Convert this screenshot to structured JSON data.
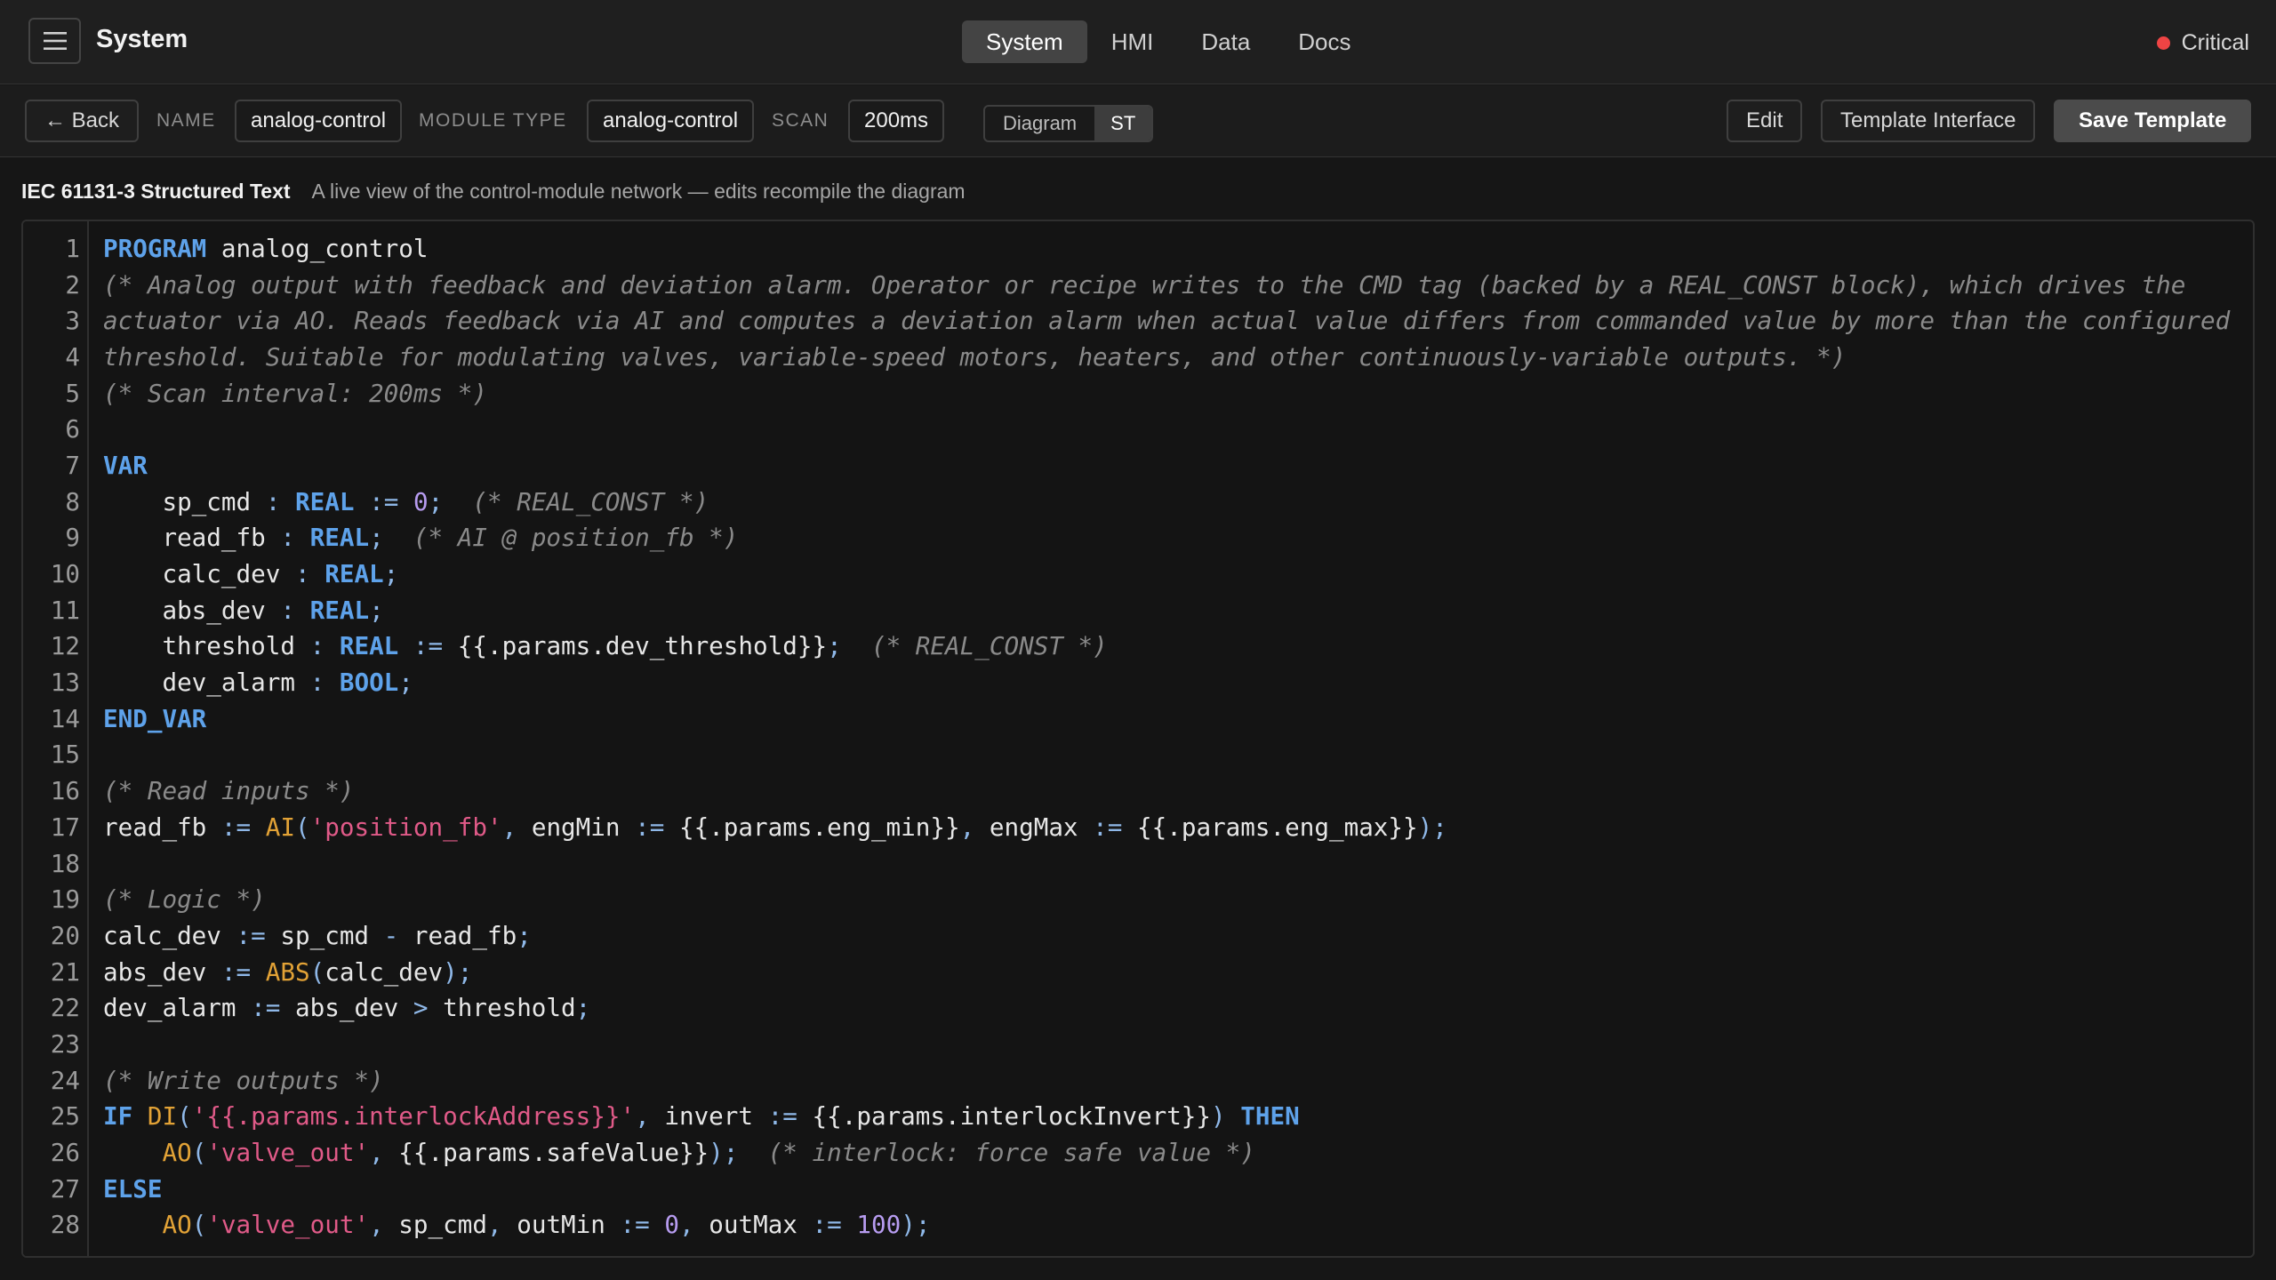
{
  "app": {
    "title": "System",
    "nav_tabs": [
      "System",
      "HMI",
      "Data",
      "Docs"
    ],
    "active_tab": "System",
    "status": {
      "label": "Critical",
      "color": "#ef4444"
    }
  },
  "toolbar": {
    "back_label": "← Back",
    "name_label": "NAME",
    "name_value": "analog-control",
    "module_type_label": "MODULE TYPE",
    "module_type_value": "analog-control",
    "scan_label": "SCAN",
    "scan_value": "200ms",
    "view_options": [
      "Diagram",
      "ST"
    ],
    "active_view": "ST",
    "edit_label": "Edit",
    "template_interface_label": "Template Interface",
    "save_template_label": "Save Template"
  },
  "section": {
    "title": "IEC 61131-3 Structured Text",
    "description": "A live view of the control-module network — edits recompile the diagram"
  },
  "editor": {
    "colors": {
      "keyword": "#5ea2ea",
      "comment": "#8a8a8a",
      "function": "#e2a236",
      "string": "#e05a88",
      "number": "#b79cf0"
    },
    "lines": [
      "PROGRAM analog_control",
      "(* Analog output with feedback and deviation alarm. Operator or recipe writes to the CMD tag (backed by a REAL_CONST block), which drives the",
      "actuator via AO. Reads feedback via AI and computes a deviation alarm when actual value differs from commanded value by more than the configured",
      "threshold. Suitable for modulating valves, variable-speed motors, heaters, and other continuously-variable outputs. *)",
      "(* Scan interval: 200ms *)",
      "",
      "VAR",
      "    sp_cmd : REAL := 0;  (* REAL_CONST *)",
      "    read_fb : REAL;  (* AI @ position_fb *)",
      "    calc_dev : REAL;",
      "    abs_dev : REAL;",
      "    threshold : REAL := {{.params.dev_threshold}};  (* REAL_CONST *)",
      "    dev_alarm : BOOL;",
      "END_VAR",
      "",
      "(* Read inputs *)",
      "read_fb := AI('position_fb', engMin := {{.params.eng_min}}, engMax := {{.params.eng_max}});",
      "",
      "(* Logic *)",
      "calc_dev := sp_cmd - read_fb;",
      "abs_dev := ABS(calc_dev);",
      "dev_alarm := abs_dev > threshold;",
      "",
      "(* Write outputs *)",
      "IF DI('{{.params.interlockAddress}}', invert := {{.params.interlockInvert}}) THEN",
      "    AO('valve_out', {{.params.safeValue}});  (* interlock: force safe value *)",
      "ELSE",
      "    AO('valve_out', sp_cmd, outMin := 0, outMax := 100);"
    ]
  }
}
